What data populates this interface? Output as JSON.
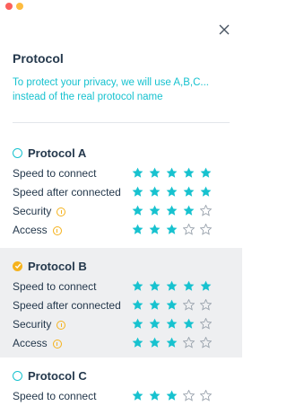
{
  "header": {
    "title": "Protocol",
    "subtitle": "To protect your privacy, we will use A,B,C... instead of the real protocol name"
  },
  "colors": {
    "accent": "#17c2cf",
    "warning": "#f5b21d",
    "text": "#24384c"
  },
  "protocols": [
    {
      "name": "Protocol A",
      "selected": false,
      "ratings": [
        {
          "label": "Speed to connect",
          "stars": 5,
          "info": false
        },
        {
          "label": "Speed after connected",
          "stars": 5,
          "info": false
        },
        {
          "label": "Security",
          "stars": 4,
          "info": true
        },
        {
          "label": "Access",
          "stars": 3,
          "info": true
        }
      ]
    },
    {
      "name": "Protocol B",
      "selected": true,
      "ratings": [
        {
          "label": "Speed to connect",
          "stars": 5,
          "info": false
        },
        {
          "label": "Speed after connected",
          "stars": 3,
          "info": false
        },
        {
          "label": "Security",
          "stars": 4,
          "info": true
        },
        {
          "label": "Access",
          "stars": 3,
          "info": true
        }
      ]
    },
    {
      "name": "Protocol C",
      "selected": false,
      "ratings": [
        {
          "label": "Speed to connect",
          "stars": 3,
          "info": false
        }
      ]
    }
  ],
  "icons": {
    "close": "close-icon",
    "info": "info-icon",
    "star": "star-icon",
    "check": "check-icon"
  }
}
